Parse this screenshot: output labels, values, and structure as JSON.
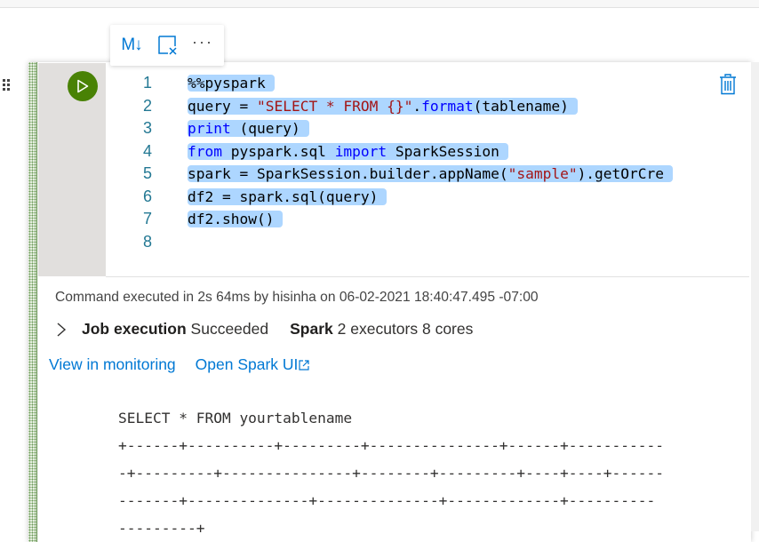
{
  "toolbar": {
    "markdown_label": "M↓",
    "markdown_icon": "markdown-icon",
    "clear_icon": "clear-output-icon",
    "more_label": "···"
  },
  "cell": {
    "run_icon": "play-icon",
    "delete_icon": "trash-icon",
    "accent_color": "#498205",
    "lines": [
      {
        "n": "1",
        "tokens": [
          {
            "t": "%%pyspark",
            "c": ""
          }
        ]
      },
      {
        "n": "2",
        "tokens": [
          {
            "t": "query = ",
            "c": ""
          },
          {
            "t": "\"SELECT * FROM {}\"",
            "c": "str"
          },
          {
            "t": ".",
            "c": ""
          },
          {
            "t": "format",
            "c": "kw"
          },
          {
            "t": "(tablename)",
            "c": ""
          }
        ]
      },
      {
        "n": "3",
        "tokens": [
          {
            "t": "print",
            "c": "kw"
          },
          {
            "t": " (query)",
            "c": ""
          }
        ]
      },
      {
        "n": "4",
        "tokens": [
          {
            "t": "from",
            "c": "kw"
          },
          {
            "t": " pyspark.sql ",
            "c": ""
          },
          {
            "t": "import",
            "c": "kw"
          },
          {
            "t": " SparkSession",
            "c": ""
          }
        ]
      },
      {
        "n": "5",
        "tokens": [
          {
            "t": "spark = SparkSession.builder.appName(",
            "c": ""
          },
          {
            "t": "\"sample\"",
            "c": "str"
          },
          {
            "t": ").getOrCre",
            "c": ""
          }
        ]
      },
      {
        "n": "6",
        "tokens": [
          {
            "t": "df2 = spark.sql(query)",
            "c": ""
          }
        ]
      },
      {
        "n": "7",
        "tokens": [
          {
            "t": "df2.show()",
            "c": ""
          }
        ]
      },
      {
        "n": "8",
        "tokens": []
      }
    ]
  },
  "output": {
    "exec_info": "Command executed in 2s 64ms by hisinha on 06-02-2021 18:40:47.495 -07:00",
    "job_label": "Job execution",
    "job_status": "Succeeded",
    "spark_label": "Spark",
    "spark_info": "2 executors 8 cores",
    "link_monitoring": "View in monitoring",
    "link_spark_ui": "Open Spark UI",
    "console_lines": [
      "SELECT * FROM yourtablename",
      "+------+----------+---------+---------------+------+-----------",
      "-+---------+---------------+--------+---------+----+----+------",
      "-------+--------------+--------------+-------------+----------",
      "---------+"
    ]
  }
}
